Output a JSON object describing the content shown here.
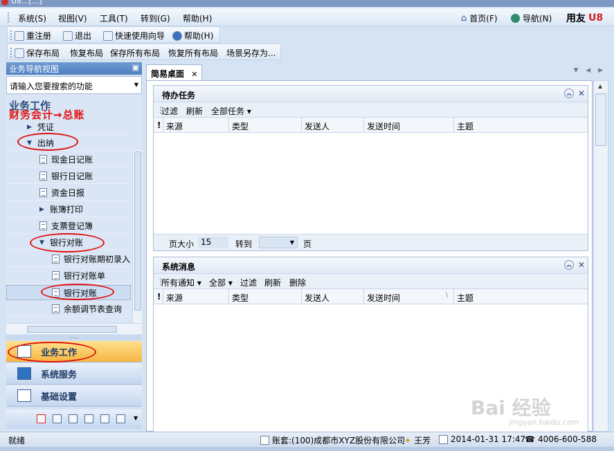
{
  "window": {
    "title": "U8...[...]"
  },
  "menu": {
    "items": [
      "系统(S)",
      "视图(V)",
      "工具(T)",
      "转到(G)",
      "帮助(H)"
    ],
    "right": {
      "home": "首页(F)",
      "nav": "导航(N)",
      "brand": "用友"
    }
  },
  "toolbar1": [
    "重注册",
    "退出",
    "快速使用向导",
    "帮助(H)"
  ],
  "toolbar2": [
    "保存布局",
    "恢复布局",
    "保存所有布局",
    "恢复所有布局",
    "场景另存为..."
  ],
  "nav": {
    "header": "业务导航视图",
    "search_placeholder": "请输入您要搜索的功能",
    "section_title": "业务工作",
    "annotation": "财务会计➞总账",
    "tree": [
      {
        "label": "凭证",
        "type": "collapsed"
      },
      {
        "label": "出纳",
        "type": "expanded"
      },
      {
        "label": "现金日记账",
        "type": "leaf"
      },
      {
        "label": "银行日记账",
        "type": "leaf"
      },
      {
        "label": "资金日报",
        "type": "leaf"
      },
      {
        "label": "账簿打印",
        "type": "collapsed"
      },
      {
        "label": "支票登记簿",
        "type": "leaf"
      },
      {
        "label": "银行对账",
        "type": "expanded"
      },
      {
        "label": "银行对账期初录入",
        "type": "leaf"
      },
      {
        "label": "银行对账单",
        "type": "leaf"
      },
      {
        "label": "银行对账",
        "type": "leaf",
        "selected": true
      },
      {
        "label": "余额调节表查询",
        "type": "leaf"
      }
    ],
    "buttons": [
      "业务工作",
      "系统服务",
      "基础设置"
    ],
    "splitter": "......."
  },
  "tabs": {
    "main": "简易桌面",
    "close": "✕",
    "controls": "▼ ◀ ▶"
  },
  "todo": {
    "title": "待办任务",
    "tools": [
      "过滤",
      "刷新",
      "全部任务 ▾"
    ],
    "columns": [
      "!",
      "来源",
      "类型",
      "发送人",
      "发送时间",
      "主题"
    ],
    "page_size_label": "页大小",
    "page_size": "15",
    "goto_label": "转到",
    "page_unit": "页"
  },
  "messages": {
    "title": "系统消息",
    "tools": [
      "所有通知 ▾",
      "全部 ▾",
      "过滤",
      "刷新",
      "删除"
    ],
    "columns": [
      "!",
      "来源",
      "类型",
      "发送人",
      "发送时间",
      "主题"
    ],
    "sort_marker": "\\"
  },
  "status": {
    "ready": "就绪",
    "account": "账套:(100)成都市XYZ股份有限公司",
    "user": "王芳",
    "datetime": "2014-01-31 17:47",
    "phone": "4006-600-588"
  },
  "watermark": {
    "main": "Bai 经验",
    "sub": "jingyan.baidu.com"
  },
  "colors": {
    "accent": "#4f7fc0",
    "active_nav": "#f6b541",
    "annotation": "#e01818"
  }
}
